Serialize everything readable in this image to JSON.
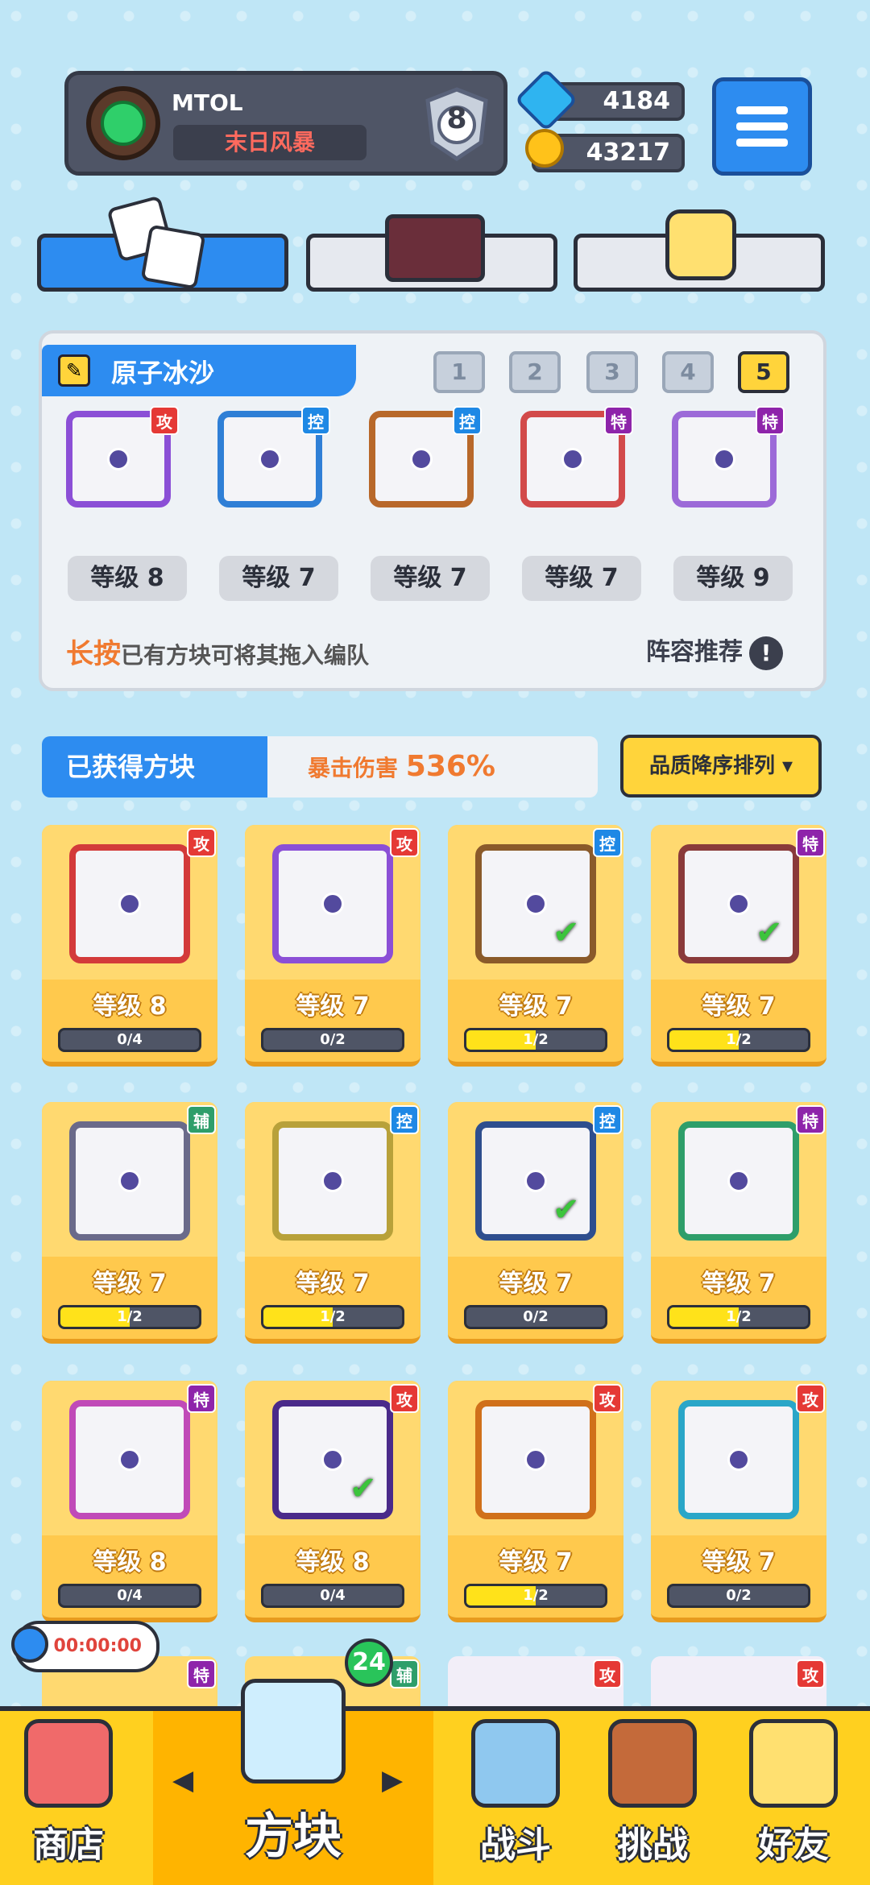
{
  "profile": {
    "name": "MTOL",
    "title": "末日风暴",
    "rank": "8"
  },
  "currency": {
    "gems": "4184",
    "coins": "43217"
  },
  "deck": {
    "name": "原子冰沙",
    "tabs": [
      "1",
      "2",
      "3",
      "4",
      "5"
    ],
    "selected_tab": "5",
    "slots": [
      {
        "type": "攻",
        "type_color": "#e53935",
        "frame_color": "#8b4fd6",
        "level": "等级 8"
      },
      {
        "type": "控",
        "type_color": "#1e88e5",
        "frame_color": "#2f7fd6",
        "level": "等级 7"
      },
      {
        "type": "控",
        "type_color": "#1e88e5",
        "frame_color": "#b8682a",
        "level": "等级 7"
      },
      {
        "type": "特",
        "type_color": "#8e24aa",
        "frame_color": "#d24a4a",
        "level": "等级 7"
      },
      {
        "type": "特",
        "type_color": "#8e24aa",
        "frame_color": "#9c6ad8",
        "level": "等级 9"
      }
    ],
    "hint_highlight": "长按",
    "hint_text": "已有方块可将其拖入编队",
    "recommend_label": "阵容推荐",
    "recommend_icon": "!"
  },
  "obtained": {
    "title": "已获得方块",
    "crit_label": "暴击伤害",
    "crit_value": "536%",
    "sort_label": "品质降序排列 ▾"
  },
  "cards": [
    {
      "type": "攻",
      "type_color": "#e53935",
      "frame_color": "#d33a3a",
      "level": "等级 8",
      "progress": "0/4",
      "fill": 0,
      "owned": false
    },
    {
      "type": "攻",
      "type_color": "#e53935",
      "frame_color": "#8b4fd6",
      "level": "等级 7",
      "progress": "0/2",
      "fill": 0,
      "owned": false
    },
    {
      "type": "控",
      "type_color": "#1e88e5",
      "frame_color": "#8a5a2a",
      "level": "等级 7",
      "progress": "1/2",
      "fill": 0.5,
      "owned": true
    },
    {
      "type": "特",
      "type_color": "#8e24aa",
      "frame_color": "#8a3a3a",
      "level": "等级 7",
      "progress": "1/2",
      "fill": 0.5,
      "owned": true
    },
    {
      "type": "辅",
      "type_color": "#2e9e6a",
      "frame_color": "#6a6a8a",
      "level": "等级 7",
      "progress": "1/2",
      "fill": 0.5,
      "owned": false
    },
    {
      "type": "控",
      "type_color": "#1e88e5",
      "frame_color": "#b8a13a",
      "level": "等级 7",
      "progress": "1/2",
      "fill": 0.5,
      "owned": false
    },
    {
      "type": "控",
      "type_color": "#1e88e5",
      "frame_color": "#2e4e8e",
      "level": "等级 7",
      "progress": "0/2",
      "fill": 0,
      "owned": true
    },
    {
      "type": "特",
      "type_color": "#8e24aa",
      "frame_color": "#2e9e6a",
      "level": "等级 7",
      "progress": "1/2",
      "fill": 0.5,
      "owned": false
    },
    {
      "type": "特",
      "type_color": "#8e24aa",
      "frame_color": "#c04ab8",
      "level": "等级 8",
      "progress": "0/4",
      "fill": 0,
      "owned": false
    },
    {
      "type": "攻",
      "type_color": "#e53935",
      "frame_color": "#4a2a8a",
      "level": "等级 8",
      "progress": "0/4",
      "fill": 0,
      "owned": true
    },
    {
      "type": "攻",
      "type_color": "#e53935",
      "frame_color": "#d0701a",
      "level": "等级 7",
      "progress": "1/2",
      "fill": 0.5,
      "owned": false
    },
    {
      "type": "攻",
      "type_color": "#e53935",
      "frame_color": "#2aa6c8",
      "level": "等级 7",
      "progress": "0/2",
      "fill": 0,
      "owned": false
    }
  ],
  "partial_row_badges": [
    "特",
    "辅",
    "攻",
    "攻"
  ],
  "timer": "00:00:00",
  "block_count": "24",
  "nav": {
    "shop": "商店",
    "blocks": "方块",
    "battle": "战斗",
    "challenge": "挑战",
    "friends": "好友",
    "prev": "◀",
    "next": "▶"
  }
}
